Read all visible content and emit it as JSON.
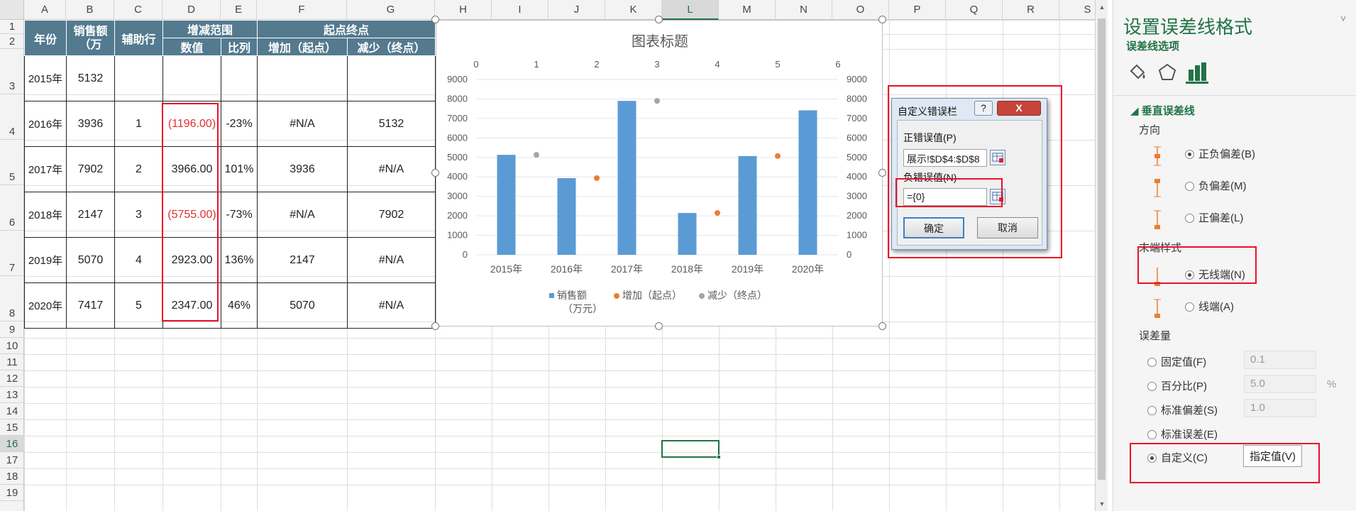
{
  "columns": [
    "A",
    "B",
    "C",
    "D",
    "E",
    "F",
    "G",
    "H",
    "I",
    "J",
    "K",
    "L",
    "M",
    "N",
    "O",
    "P",
    "Q",
    "R",
    "S"
  ],
  "selected_column": "L",
  "rows": [
    "1",
    "2",
    "3",
    "4",
    "5",
    "6",
    "7",
    "8",
    "9",
    "10",
    "11",
    "12",
    "13",
    "14",
    "15",
    "16",
    "17",
    "18",
    "19"
  ],
  "selected_row": "16",
  "table": {
    "h_year": "年份",
    "h_sales": "销售额（万",
    "h_aux": "辅助行",
    "h_range": "增减范围",
    "h_value": "数值",
    "h_ratio": "比列",
    "h_startend": "起点终点",
    "h_inc": "增加（起点）",
    "h_dec": "减少（终点）",
    "rows": [
      {
        "year": "2015年",
        "sales": "5132",
        "aux": "",
        "value": "",
        "ratio": "",
        "inc": "",
        "dec": ""
      },
      {
        "year": "2016年",
        "sales": "3936",
        "aux": "1",
        "value": "(1196.00)",
        "ratio": "-23%",
        "inc": "#N/A",
        "dec": "5132"
      },
      {
        "year": "2017年",
        "sales": "7902",
        "aux": "2",
        "value": "3966.00",
        "ratio": "101%",
        "inc": "3936",
        "dec": "#N/A"
      },
      {
        "year": "2018年",
        "sales": "2147",
        "aux": "3",
        "value": "(5755.00)",
        "ratio": "-73%",
        "inc": "#N/A",
        "dec": "7902"
      },
      {
        "year": "2019年",
        "sales": "5070",
        "aux": "4",
        "value": "2923.00",
        "ratio": "136%",
        "inc": "2147",
        "dec": "#N/A"
      },
      {
        "year": "2020年",
        "sales": "7417",
        "aux": "5",
        "value": "2347.00",
        "ratio": "46%",
        "inc": "5070",
        "dec": "#N/A"
      }
    ]
  },
  "chart_data": {
    "type": "bar",
    "title": "图表标题",
    "categories": [
      "2015年",
      "2016年",
      "2017年",
      "2018年",
      "2019年",
      "2020年"
    ],
    "series": [
      {
        "name": "销售额（万元）",
        "type": "bar",
        "color": "#5b9bd5",
        "values": [
          5132,
          3936,
          7902,
          2147,
          5070,
          7417
        ]
      },
      {
        "name": "增加（起点）",
        "type": "scatter",
        "color": "#ed7d31",
        "points": [
          [
            2,
            3936
          ],
          [
            4,
            2147
          ],
          [
            5,
            5070
          ]
        ]
      },
      {
        "name": "减少（终点）",
        "type": "scatter",
        "color": "#a5a5a5",
        "points": [
          [
            1,
            5132
          ],
          [
            3,
            7902
          ]
        ]
      }
    ],
    "yticks": [
      "0",
      "1000",
      "2000",
      "3000",
      "4000",
      "5000",
      "6000",
      "7000",
      "8000",
      "9000"
    ],
    "ylim": [
      0,
      9000
    ],
    "x2ticks": [
      "0",
      "1",
      "2",
      "3",
      "4",
      "5",
      "6"
    ],
    "x2lim": [
      0,
      6
    ],
    "legend": "bottom"
  },
  "dialog": {
    "title": "自定义错误栏",
    "help": "?",
    "close": "X",
    "pos_label": "正错误值(P)",
    "pos_value": "展示!$D$4:$D$8",
    "neg_label": "负错误值(N)",
    "neg_value": "={0}",
    "ok": "确定",
    "cancel": "取消"
  },
  "pane": {
    "title": "设置误差线格式",
    "subtitle": "误差线选项",
    "close": "˅",
    "section": "垂直误差线",
    "direction_label": "方向",
    "directions": [
      "正负偏差(B)",
      "负偏差(M)",
      "正偏差(L)"
    ],
    "endstyle_label": "末端样式",
    "endstyles": [
      "无线端(N)",
      "线端(A)"
    ],
    "amount_label": "误差量",
    "fixed": "固定值(F)",
    "fixed_val": "0.1",
    "percent": "百分比(P)",
    "percent_val": "5.0",
    "percent_unit": "%",
    "stddev": "标准偏差(S)",
    "stddev_val": "1.0",
    "stderr": "标准误差(E)",
    "custom": "自定义(C)",
    "specify": "指定值(V)"
  },
  "colors": {
    "accent": "#217346",
    "header_fill": "#547a8f",
    "highlight": "#e8102a",
    "bar": "#5b9bd5",
    "orange": "#ed7d31"
  }
}
